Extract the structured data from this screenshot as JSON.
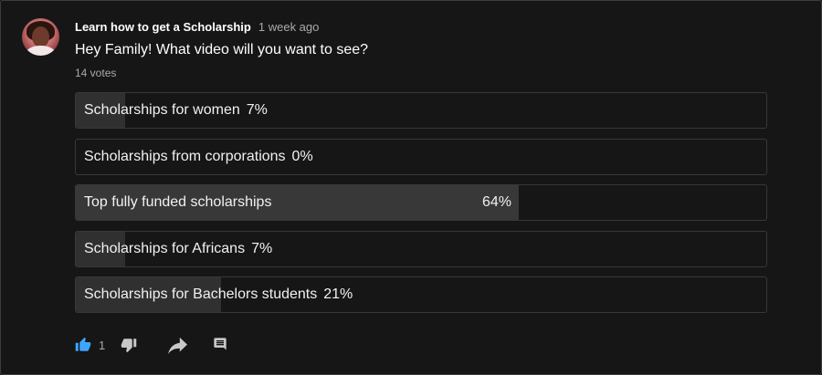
{
  "post": {
    "author": "Learn how to get a Scholarship",
    "time": "1 week ago",
    "question": "Hey Family! What video will you want to see?",
    "votes": "14 votes"
  },
  "poll": {
    "options": [
      {
        "label": "Scholarships for women",
        "percent_label": "7%",
        "percent": 7,
        "selected": false
      },
      {
        "label": "Scholarships from corporations",
        "percent_label": "0%",
        "percent": 0,
        "selected": false
      },
      {
        "label": "Top fully funded scholarships",
        "percent_label": "64%",
        "percent": 64,
        "selected": true
      },
      {
        "label": "Scholarships for Africans",
        "percent_label": "7%",
        "percent": 7,
        "selected": false
      },
      {
        "label": "Scholarships for Bachelors students",
        "percent_label": "21%",
        "percent": 21,
        "selected": false
      }
    ]
  },
  "actions": {
    "like_count": "1",
    "icons": [
      "thumbs-up-icon",
      "thumbs-down-icon",
      "share-icon",
      "comment-icon"
    ],
    "accent_color": "#3ea6ff"
  }
}
